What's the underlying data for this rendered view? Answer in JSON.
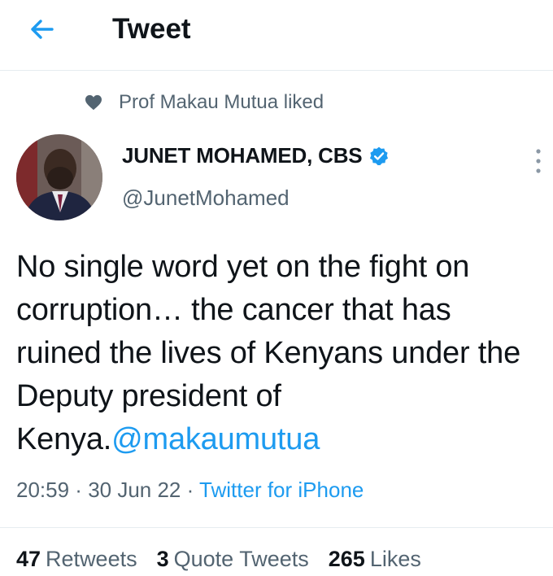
{
  "header": {
    "title": "Tweet",
    "back_icon": "arrow-left-icon"
  },
  "social_context": {
    "text": "Prof Makau Mutua liked",
    "icon": "heart-icon"
  },
  "author": {
    "name": "JUNET MOHAMED, CBS",
    "handle": "@JunetMohamed",
    "verified_icon": "verified-badge-icon"
  },
  "tweet": {
    "text": "No single word yet on the fight on corruption… the cancer that has ruined the lives of Kenyans under the Deputy president of Kenya.",
    "mention": "@makaumutua"
  },
  "meta": {
    "time": "20:59",
    "sep1": " · ",
    "date": "30 Jun 22",
    "sep2": " · ",
    "source": "Twitter for iPhone"
  },
  "stats": {
    "retweets_count": "47",
    "retweets_label": "Retweets",
    "quotes_count": "3",
    "quotes_label": "Quote Tweets",
    "likes_count": "265",
    "likes_label": "Likes"
  },
  "colors": {
    "accent": "#1d9bf0",
    "secondary_text": "#536471",
    "divider": "#e6ecf0"
  }
}
